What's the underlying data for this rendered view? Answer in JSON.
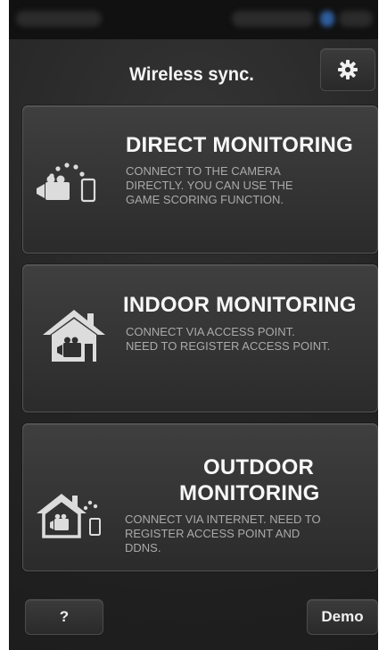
{
  "header": {
    "title": "Wireless sync.",
    "settings_icon": "gear-icon"
  },
  "options": [
    {
      "title": "DIRECT MONITORING",
      "description": "CONNECT TO THE CAMERA\nDIRECTLY. YOU CAN USE THE\nGAME SCORING FUNCTION.",
      "icon": "camera-phone-direct-icon"
    },
    {
      "title": "INDOOR MONITORING",
      "description": "CONNECT VIA ACCESS POINT.\nNEED TO REGISTER ACCESS POINT.",
      "icon": "house-camera-icon"
    },
    {
      "title_line1": "OUTDOOR",
      "title_line2": "MONITORING",
      "description": "CONNECT VIA INTERNET. NEED TO\nREGISTER ACCESS POINT AND\nDDNS.",
      "icon": "house-camera-phone-icon"
    }
  ],
  "footer": {
    "help_label": "?",
    "demo_label": "Demo"
  },
  "colors": {
    "background": "#252525",
    "card": "#363636",
    "title_text": "#f7f7f7",
    "description_text": "#aaaaaa"
  }
}
